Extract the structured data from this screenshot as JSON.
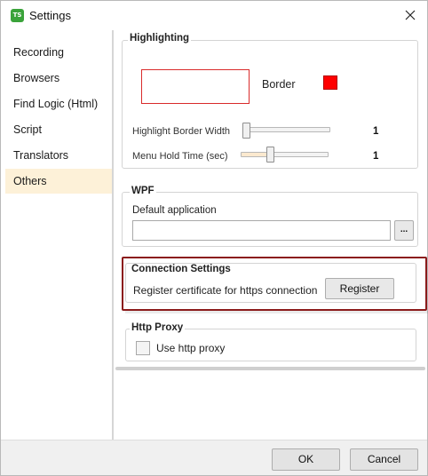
{
  "window": {
    "title": "Settings",
    "app_icon_text": "TS",
    "icon": "close-icon"
  },
  "sidebar": {
    "items": [
      {
        "label": "Recording",
        "active": false
      },
      {
        "label": "Browsers",
        "active": false
      },
      {
        "label": "Find Logic (Html)",
        "active": false
      },
      {
        "label": "Script",
        "active": false
      },
      {
        "label": "Translators",
        "active": false
      },
      {
        "label": "Others",
        "active": true
      }
    ]
  },
  "highlighting": {
    "title": "Highlighting",
    "border_label": "Border",
    "border_color": "#ff0000",
    "border_width_label": "Highlight Border Width",
    "border_width_value": "1",
    "menu_hold_label": "Menu Hold Time (sec)",
    "menu_hold_value": "1",
    "border_width_level": 0.0,
    "menu_hold_level": 0.33
  },
  "wpf": {
    "title": "WPF",
    "default_app_label": "Default application",
    "default_app_value": "",
    "browse_label": "..."
  },
  "connection": {
    "title": "Connection Settings",
    "register_text": "Register certificate for https connection",
    "register_button": "Register"
  },
  "proxy": {
    "title": "Http Proxy",
    "use_proxy_label": "Use http proxy",
    "use_proxy_checked": false
  },
  "footer": {
    "ok_label": "OK",
    "cancel_label": "Cancel"
  }
}
